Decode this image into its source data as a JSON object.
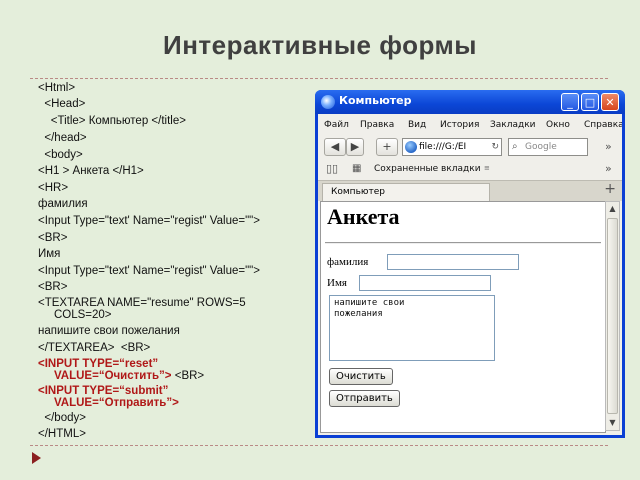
{
  "slide": {
    "title": "Интерактивные формы"
  },
  "code": {
    "lines": [
      "<Html>",
      "  <Head>",
      "    <Title> Компьютер </title>",
      "  </head>",
      "  <body>",
      "<H1 > Анкета </H1>",
      "<HR>",
      "фамилия",
      "<Input Type=\"text' Name=\"regist\" Value=\"\">",
      "<BR>",
      "Имя",
      "<Input Type=\"text' Name=\"regist\" Value=\"\">",
      "<BR>",
      "<TEXTAREA NAME=\"resume\" ROWS=5",
      "     COLS=20>",
      "напишите свои пожелания",
      "</TEXTAREA>  <BR>"
    ],
    "reset_line1": "<INPUT TYPE=“reset”",
    "reset_line2": "     VALUE=“Очистить”>",
    "reset_tail": " <BR>",
    "submit_line1": "<INPUT TYPE=“submit”",
    "submit_line2": "     VALUE=“Отправить”>",
    "end_lines": [
      "  </body>",
      "</HTML>"
    ]
  },
  "browser": {
    "window_title": "Компьютер",
    "menu": [
      "Файл",
      "Правка",
      "Вид",
      "История",
      "Закладки",
      "Окно",
      "Справка"
    ],
    "url": "file:///G:/EI",
    "search_placeholder": "Google",
    "bookmarks_label": "Сохраненные вкладки",
    "tab_label": "Компьютер",
    "icons": {
      "back": "back-arrow-icon",
      "forward": "forward-arrow-icon",
      "add": "plus-icon",
      "reload": "reload-icon",
      "search": "search-icon"
    }
  },
  "form": {
    "heading": "Анкета",
    "surname_label": "фамилия",
    "name_label": "Имя",
    "textarea_text": "напишите свои\nпожелания",
    "reset_label": "Очистить",
    "submit_label": "Отправить"
  },
  "colors": {
    "background": "#e4eedb",
    "title": "#404040",
    "code_highlight": "#b01818",
    "window_blue": "#0a3fd4"
  }
}
